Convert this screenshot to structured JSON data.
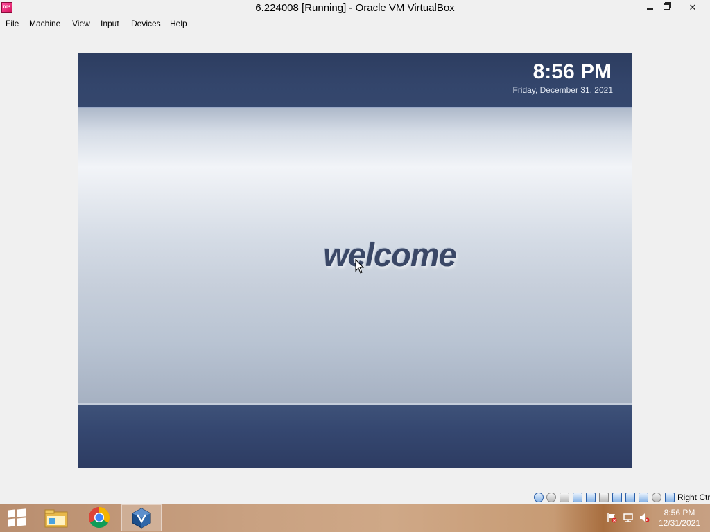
{
  "window": {
    "title": "6.224008 [Running] - Oracle VM VirtualBox",
    "icon_name": "virtualbox-vm-icon",
    "controls": {
      "minimize": "minimize-icon",
      "maximize": "restore-icon",
      "close": "close-icon"
    }
  },
  "menu": {
    "file": "File",
    "machine": "Machine",
    "view": "View",
    "input": "Input",
    "devices": "Devices",
    "help": "Help"
  },
  "vm": {
    "clock": "8:56 PM",
    "date": "Friday, December 31, 2021",
    "welcome": "welcome",
    "colors": {
      "header": "#2e3e62",
      "welcome_text": "#3a4766"
    }
  },
  "statusbar": {
    "host_key": "Right Ctrl",
    "icons": [
      "hard-disk-icon",
      "optical-drive-icon",
      "floppy-icon",
      "network-icon",
      "usb-icon",
      "shared-folder-icon",
      "display-icon",
      "video-capture-icon",
      "cpu-icon",
      "mouse-integration-icon",
      "keyboard-icon"
    ]
  },
  "taskbar": {
    "start_icon": "windows-start-icon",
    "apps": [
      "file-explorer-icon",
      "chrome-icon",
      "virtualbox-icon"
    ],
    "tray_icons": [
      "action-center-flag-icon",
      "network-icon",
      "volume-muted-icon"
    ],
    "time": "8:56 PM",
    "date": "12/31/2021"
  }
}
